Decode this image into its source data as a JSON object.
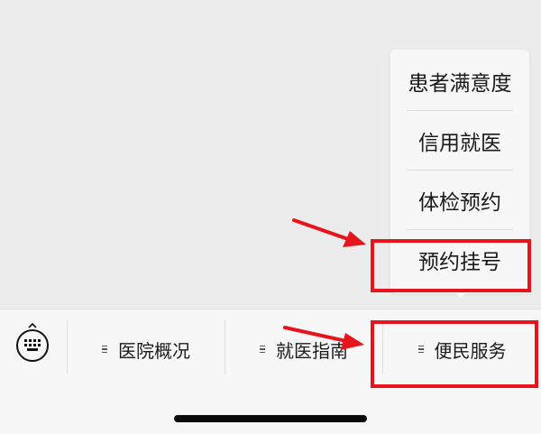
{
  "popup_menu": {
    "items": [
      {
        "label": "患者满意度"
      },
      {
        "label": "信用就医"
      },
      {
        "label": "体检预约"
      },
      {
        "label": "预约挂号"
      }
    ]
  },
  "tabbar": {
    "tabs": [
      {
        "label": "医院概况"
      },
      {
        "label": "就医指南"
      },
      {
        "label": "便民服务"
      }
    ]
  },
  "annotations": {
    "highlight_color": "#e8141b"
  }
}
